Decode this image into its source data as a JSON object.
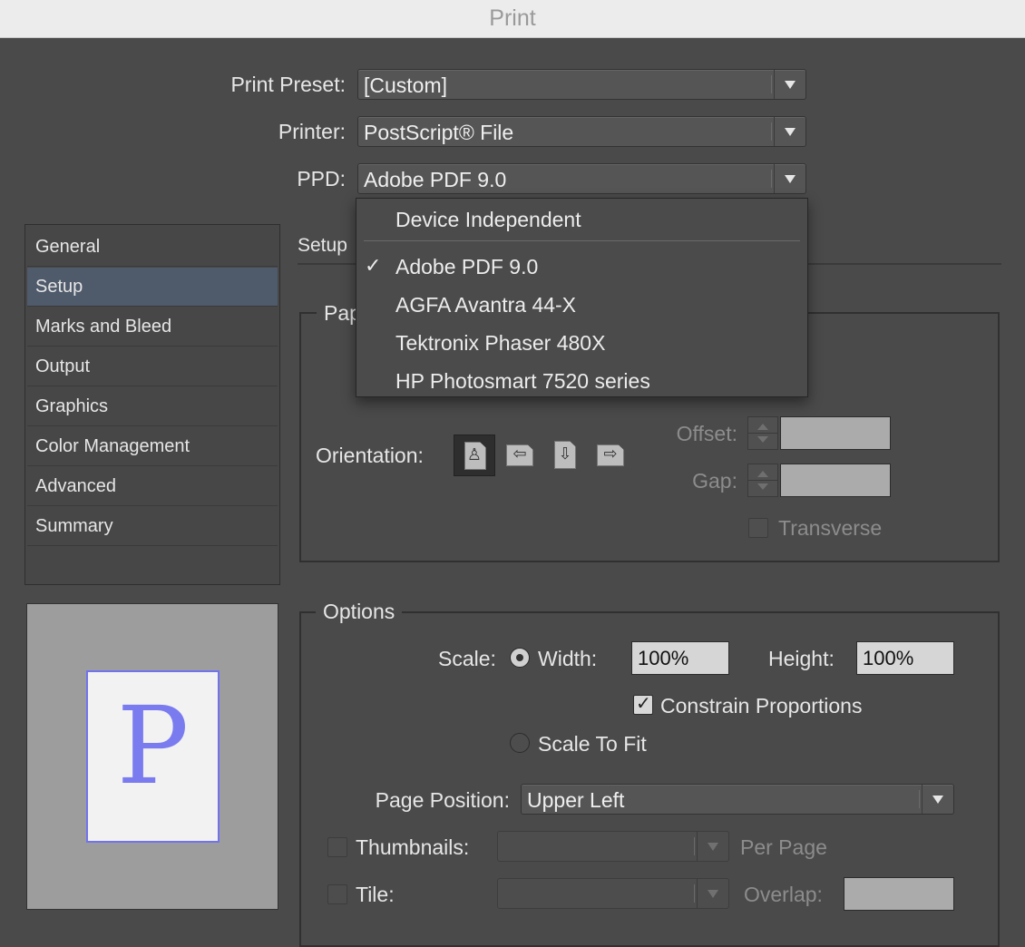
{
  "window": {
    "title": "Print"
  },
  "header": {
    "preset": {
      "label": "Print Preset:",
      "value": "[Custom]"
    },
    "printer": {
      "label": "Printer:",
      "value": "PostScript® File"
    },
    "ppd": {
      "label": "PPD:",
      "value": "Adobe PDF 9.0"
    }
  },
  "ppd_menu": {
    "items": [
      {
        "label": "Device Independent",
        "checked": false
      },
      {
        "label": "Adobe PDF 9.0",
        "checked": true
      },
      {
        "label": "AGFA Avantra 44-X",
        "checked": false
      },
      {
        "label": "Tektronix Phaser 480X",
        "checked": false
      },
      {
        "label": "HP Photosmart 7520 series",
        "checked": false
      }
    ],
    "check_glyph": "✓"
  },
  "sidebar": {
    "items": [
      {
        "label": "General"
      },
      {
        "label": "Setup"
      },
      {
        "label": "Marks and Bleed"
      },
      {
        "label": "Output"
      },
      {
        "label": "Graphics"
      },
      {
        "label": "Color Management"
      },
      {
        "label": "Advanced"
      },
      {
        "label": "Summary"
      }
    ],
    "selected": "Setup"
  },
  "preview": {
    "letter": "P",
    "accent": "#7173ee"
  },
  "setup": {
    "heading": "Setup",
    "paper_legend_partial": "Pap",
    "orientation_label": "Orientation:",
    "orientation_selected": "portrait",
    "offset_label": "Offset:",
    "gap_label": "Gap:",
    "transverse_label": "Transverse"
  },
  "options": {
    "legend": "Options",
    "scale_label": "Scale:",
    "width_label": "Width:",
    "width_value": "100%",
    "height_label": "Height:",
    "height_value": "100%",
    "constrain_label": "Constrain Proportions",
    "constrain_checked": true,
    "scale_to_fit_label": "Scale To Fit",
    "page_position_label": "Page Position:",
    "page_position_value": "Upper Left",
    "thumbnails_label": "Thumbnails:",
    "per_page_label": "Per Page",
    "tile_label": "Tile:",
    "overlap_label": "Overlap:"
  }
}
